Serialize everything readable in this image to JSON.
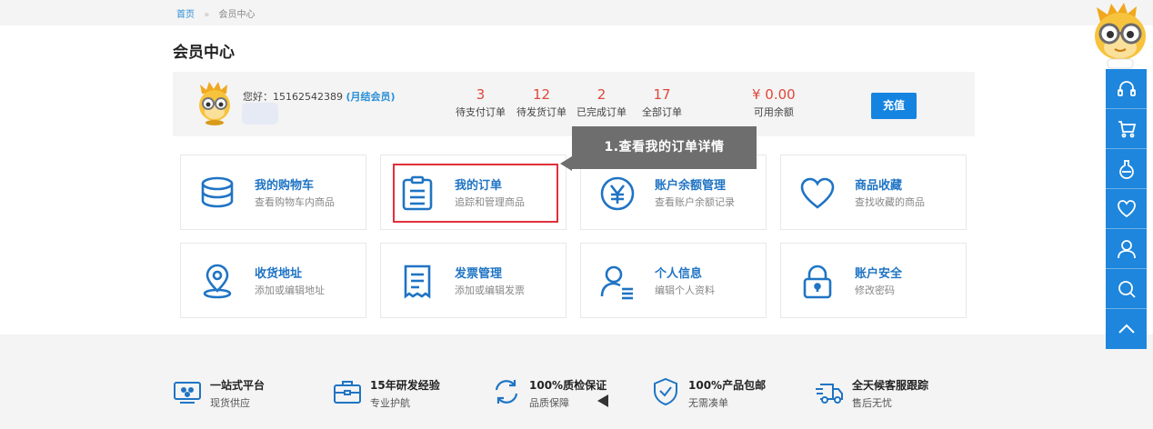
{
  "breadcrumb": {
    "home": "首页",
    "sep": "»",
    "current": "会员中心"
  },
  "page_title": "会员中心",
  "account": {
    "greeting_prefix": "您好：",
    "phone": "15162542389",
    "member_tag": "(月结会员)"
  },
  "stats": [
    {
      "value": "3",
      "label": "待支付订单"
    },
    {
      "value": "12",
      "label": "待发货订单"
    },
    {
      "value": "2",
      "label": "已完成订单"
    },
    {
      "value": "17",
      "label": "全部订单"
    },
    {
      "value": "¥ 0.00",
      "label": "可用余额"
    }
  ],
  "recharge_label": "充值",
  "tooltip": "1.查看我的订单详情",
  "cards": [
    {
      "title": "我的购物车",
      "sub": "查看购物车内商品",
      "icon": "database-cart-icon"
    },
    {
      "title": "我的订单",
      "sub": "追踪和管理商品",
      "icon": "clipboard-icon"
    },
    {
      "title": "账户余额管理",
      "sub": "查看账户余额记录",
      "icon": "yen-icon"
    },
    {
      "title": "商品收藏",
      "sub": "查找收藏的商品",
      "icon": "heart-icon"
    },
    {
      "title": "收货地址",
      "sub": "添加或编辑地址",
      "icon": "location-pin-icon"
    },
    {
      "title": "发票管理",
      "sub": "添加或编辑发票",
      "icon": "invoice-icon"
    },
    {
      "title": "个人信息",
      "sub": "编辑个人资料",
      "icon": "user-profile-icon"
    },
    {
      "title": "账户安全",
      "sub": "修改密码",
      "icon": "lock-icon"
    }
  ],
  "footer": [
    {
      "title": "一站式平台",
      "sub": "现货供应",
      "icon": "platform-icon"
    },
    {
      "title": "15年研发经验",
      "sub": "专业护航",
      "icon": "briefcase-icon"
    },
    {
      "title": "100%质检保证",
      "sub": "品质保障",
      "icon": "refresh-icon"
    },
    {
      "title": "100%产品包邮",
      "sub": "无需凑单",
      "icon": "shield-check-icon"
    },
    {
      "title": "全天候客服跟踪",
      "sub": "售后无忧",
      "icon": "delivery-truck-icon"
    }
  ],
  "sidebar_icons": [
    "headset-icon",
    "cart-icon",
    "flask-icon",
    "heart-icon",
    "user-icon",
    "search-icon",
    "chevron-up-icon"
  ],
  "colors": {
    "accent": "#1e86dc",
    "link": "#1f74c4",
    "alert": "#e0463a",
    "highlight": "#e0303a"
  }
}
